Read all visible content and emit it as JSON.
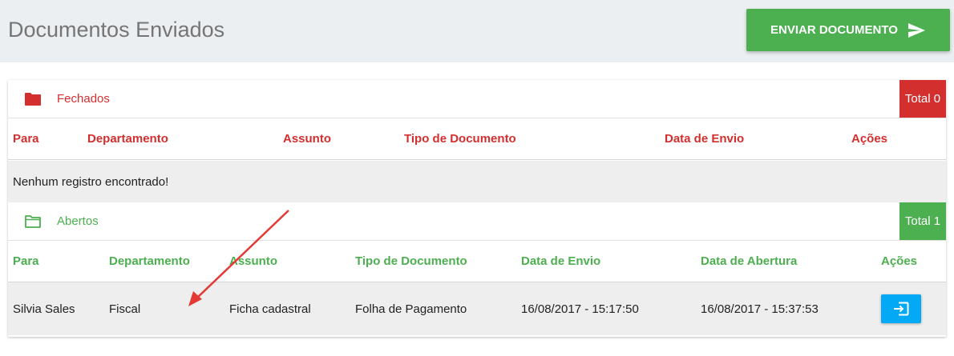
{
  "header": {
    "title": "Documentos Enviados",
    "send_button_label": "ENVIAR DOCUMENTO"
  },
  "closed": {
    "label": "Fechados",
    "total": "Total 0",
    "columns": [
      "Para",
      "Departamento",
      "Assunto",
      "Tipo de Documento",
      "Data de Envio",
      "Ações"
    ],
    "empty_message": "Nenhum registro encontrado!"
  },
  "open": {
    "label": "Abertos",
    "total": "Total 1",
    "columns": [
      "Para",
      "Departamento",
      "Assunto",
      "Tipo de Documento",
      "Data de Envio",
      "Data de Abertura",
      "Ações"
    ],
    "rows": [
      {
        "para": "Silvia Sales",
        "departamento": "Fiscal",
        "assunto": "Ficha cadastral",
        "tipo": "Folha de Pagamento",
        "data_envio": "16/08/2017 - 15:17:50",
        "data_abertura": "16/08/2017 - 15:37:53"
      }
    ]
  },
  "colors": {
    "closed": "#d32f2f",
    "open": "#4caf50",
    "action": "#03a9f4",
    "annotation": "#e53935"
  },
  "icons": {
    "send": "send-icon",
    "closed_folder": "folder-filled-icon",
    "open_folder": "folder-outline-icon",
    "action": "exit-to-app-icon"
  }
}
